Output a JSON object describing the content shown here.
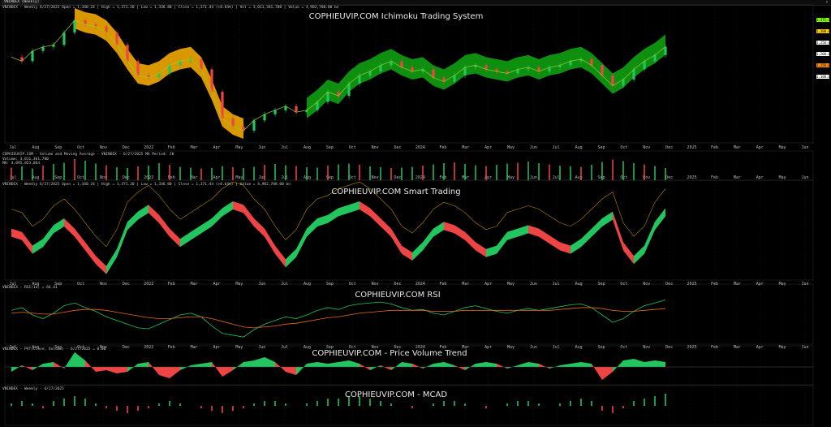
{
  "window": {
    "tab_label": "VNINDEX (Weekly)",
    "close_glyph": "×"
  },
  "panes": {
    "ichimoku": {
      "title": "COPHIEUVIP.COM Ichimoku Trading System",
      "header": "VNINDEX - Weekly 6/27/2025 Open = 1,340.24 | High = 1,371.20 | Low = 1,336.80 | Close = 1,371.44 (+8.64%) | Vol = 3,011,361,780 | Value = 4,902,708.00 bn"
    },
    "volume": {
      "header": "COPHIEUVIP.COM - Volume and Moving Average - VNINDEX - 6/27/2025 MA Period: 20",
      "lines": [
        "Volume: 3,011,361,780",
        "MA: 4,095,853,064"
      ]
    },
    "smart": {
      "title": "COPHIEUVIP.COM Smart Trading",
      "header": "VNINDEX - Weekly 6/27/2025 Open = 1,340.24 | High = 1,371.20 | Low = 1,336.80 | Close = 1,371.44 (+8.64%) | Value = 4,902,708.00 bn"
    },
    "rsi": {
      "title": "COPHIEUVIP.COM RSI",
      "header": "VNINDEX - RSI(14) = 66.41"
    },
    "pvt": {
      "title": "COPHIEUVIP.COM - Price Volume Trend",
      "header": "VNINDEX - PVT(Close, Volume) - 6/27/2025 = 0.00"
    },
    "macd": {
      "title": "COPHIEUVIP.COM - MCAD",
      "header": "VNINDEX - Weekly - 6/27/2025"
    }
  },
  "x_axis_labels": [
    "Jul",
    "Aug",
    "Sep",
    "Oct",
    "Nov",
    "Dec",
    "2022",
    "Feb",
    "Mar",
    "Apr",
    "May",
    "Jun",
    "Jul",
    "Aug",
    "Sep",
    "Oct",
    "Nov",
    "Dec",
    "2024",
    "Feb",
    "Mar",
    "Apr",
    "May",
    "Jun",
    "Jul",
    "Aug",
    "Sep",
    "Oct",
    "Nov",
    "Dec",
    "2025",
    "Feb",
    "Mar",
    "Apr",
    "May",
    "Jun"
  ],
  "right_price_tags": [
    {
      "text": "1,371.44",
      "color": "#7CFC00"
    },
    {
      "text": "1,300.00",
      "color": "#ffd000"
    },
    {
      "text": "1,250.00",
      "color": "#ffffff"
    },
    {
      "text": "1,200.00",
      "color": "#ffffff"
    },
    {
      "text": "1,150.00",
      "color": "#ff8c00"
    },
    {
      "text": "1,100.00",
      "color": "#ffffff"
    }
  ],
  "colors": {
    "up": "#22c55e",
    "down": "#ef4444",
    "cloud_green": "#12a812",
    "cloud_orange": "#ffb300",
    "grid": "#1c1c1c"
  },
  "chart_data": [
    {
      "type": "line",
      "title": "COPHIEUVIP.COM Ichimoku Trading System",
      "series": [
        {
          "values": [
            1320,
            1300,
            1350,
            1370,
            1380,
            1440,
            1500,
            1480,
            1470,
            1440,
            1380,
            1300,
            1230,
            1220,
            1240,
            1280,
            1300,
            1310,
            1260,
            1150,
            1020,
            980,
            960,
            1010,
            1040,
            1060,
            1080,
            1050,
            1060,
            1100,
            1150,
            1130,
            1190,
            1230,
            1250,
            1280,
            1300,
            1270,
            1250,
            1260,
            1220,
            1200,
            1230,
            1270,
            1280,
            1260,
            1250,
            1240,
            1260,
            1270,
            1250,
            1270,
            1280,
            1300,
            1310,
            1280,
            1230,
            1180,
            1210,
            1260,
            1300,
            1330,
            1371
          ]
        }
      ]
    },
    {
      "type": "bar",
      "title": "Volume",
      "values": [
        3.1,
        3.4,
        2.9,
        3.6,
        4.0,
        4.3,
        5.2,
        4.8,
        4.1,
        3.7,
        3.2,
        3.0,
        3.4,
        3.6,
        4.2,
        3.8,
        3.3,
        3.1,
        2.9,
        3.0,
        3.5,
        3.2,
        3.0,
        3.3,
        3.8,
        4.0,
        3.7,
        3.5,
        3.2,
        3.1,
        3.6,
        3.9,
        4.1,
        3.8,
        3.4,
        3.2,
        3.0,
        3.1,
        3.3,
        3.6,
        3.9,
        4.2,
        4.4,
        4.0,
        3.7,
        3.5,
        3.8,
        4.1,
        4.3,
        4.6,
        4.2,
        3.9,
        3.6,
        3.4,
        3.3,
        3.8,
        4.5,
        5.1,
        4.7,
        4.2,
        3.9,
        3.5,
        3.0
      ]
    },
    {
      "type": "area",
      "title": "COPHIEUVIP.COM Smart Trading",
      "values": [
        0.2,
        0.1,
        -0.3,
        -0.1,
        0.3,
        0.5,
        0.2,
        -0.2,
        -0.6,
        -0.9,
        -0.4,
        0.4,
        0.7,
        0.9,
        0.6,
        0.2,
        -0.1,
        0.1,
        0.3,
        0.5,
        0.8,
        1.0,
        0.9,
        0.5,
        0.2,
        -0.3,
        -0.7,
        -0.4,
        0.2,
        0.5,
        0.6,
        0.8,
        0.9,
        1.0,
        0.8,
        0.5,
        0.2,
        -0.3,
        -0.5,
        -0.2,
        0.2,
        0.4,
        0.3,
        0.1,
        -0.2,
        -0.4,
        -0.3,
        0.1,
        0.2,
        0.3,
        0.2,
        0.0,
        -0.2,
        -0.3,
        -0.1,
        0.2,
        0.5,
        0.7,
        -0.2,
        -0.6,
        -0.3,
        0.4,
        0.8
      ]
    },
    {
      "type": "line",
      "title": "COPHIEUVIP.COM RSI",
      "series": [
        {
          "values": [
            55,
            58,
            50,
            46,
            52,
            60,
            63,
            58,
            54,
            48,
            44,
            40,
            36,
            35,
            40,
            45,
            50,
            52,
            48,
            38,
            30,
            28,
            26,
            34,
            40,
            44,
            48,
            46,
            50,
            55,
            58,
            56,
            60,
            62,
            63,
            64,
            62,
            58,
            55,
            56,
            52,
            50,
            54,
            58,
            60,
            57,
            54,
            52,
            55,
            57,
            55,
            57,
            59,
            61,
            62,
            58,
            50,
            42,
            46,
            54,
            60,
            63,
            66.41
          ]
        },
        {
          "values": [
            52,
            53,
            52,
            51,
            51,
            53,
            55,
            56,
            56,
            55,
            53,
            51,
            49,
            47,
            46,
            46,
            47,
            48,
            48,
            46,
            43,
            40,
            37,
            36,
            37,
            38,
            40,
            41,
            43,
            45,
            47,
            48,
            50,
            52,
            53,
            54,
            55,
            55,
            55,
            55,
            54,
            54,
            54,
            55,
            55,
            55,
            55,
            55,
            55,
            55,
            55,
            55,
            56,
            57,
            58,
            58,
            57,
            55,
            54,
            54,
            55,
            56,
            57
          ]
        }
      ]
    },
    {
      "type": "area",
      "title": "COPHIEUVIP.COM - Price Volume Trend",
      "values": [
        -0.3,
        0.1,
        -0.2,
        0.2,
        0.3,
        -0.1,
        0.9,
        0.4,
        -0.3,
        -0.2,
        -0.4,
        -0.3,
        0.2,
        0.3,
        -0.5,
        -0.7,
        -0.2,
        0.1,
        0.2,
        0.3,
        -0.6,
        -0.2,
        0.3,
        0.4,
        0.6,
        0.3,
        -0.3,
        -0.5,
        0.2,
        0.3,
        0.2,
        0.3,
        0.4,
        0.2,
        -0.2,
        0.1,
        -0.2,
        0.3,
        0.2,
        -0.1,
        0.2,
        0.3,
        0.1,
        -0.2,
        0.2,
        0.3,
        0.2,
        -0.1,
        0.1,
        0.3,
        0.2,
        -0.1,
        0.1,
        0.2,
        0.3,
        0.2,
        -0.8,
        -0.3,
        0.4,
        0.5,
        0.3,
        0.4,
        0.3
      ]
    },
    {
      "type": "bar",
      "title": "COPHIEUVIP.COM - MCAD",
      "values": [
        0.1,
        0.2,
        0.1,
        -0.1,
        0.2,
        0.3,
        0.4,
        0.3,
        0.1,
        -0.1,
        -0.2,
        -0.3,
        -0.2,
        -0.1,
        0.1,
        0.2,
        0.1,
        0.0,
        -0.1,
        -0.2,
        -0.3,
        -0.2,
        -0.1,
        0.1,
        0.2,
        0.2,
        0.1,
        0.0,
        0.1,
        0.2,
        0.3,
        0.3,
        0.4,
        0.4,
        0.3,
        0.2,
        0.1,
        0.0,
        -0.1,
        0.0,
        0.1,
        0.2,
        0.2,
        0.1,
        0.0,
        -0.1,
        0.0,
        0.1,
        0.2,
        0.2,
        0.1,
        0.0,
        0.1,
        0.2,
        0.3,
        0.2,
        -0.2,
        -0.3,
        -0.1,
        0.2,
        0.3,
        0.4,
        0.5
      ]
    }
  ]
}
